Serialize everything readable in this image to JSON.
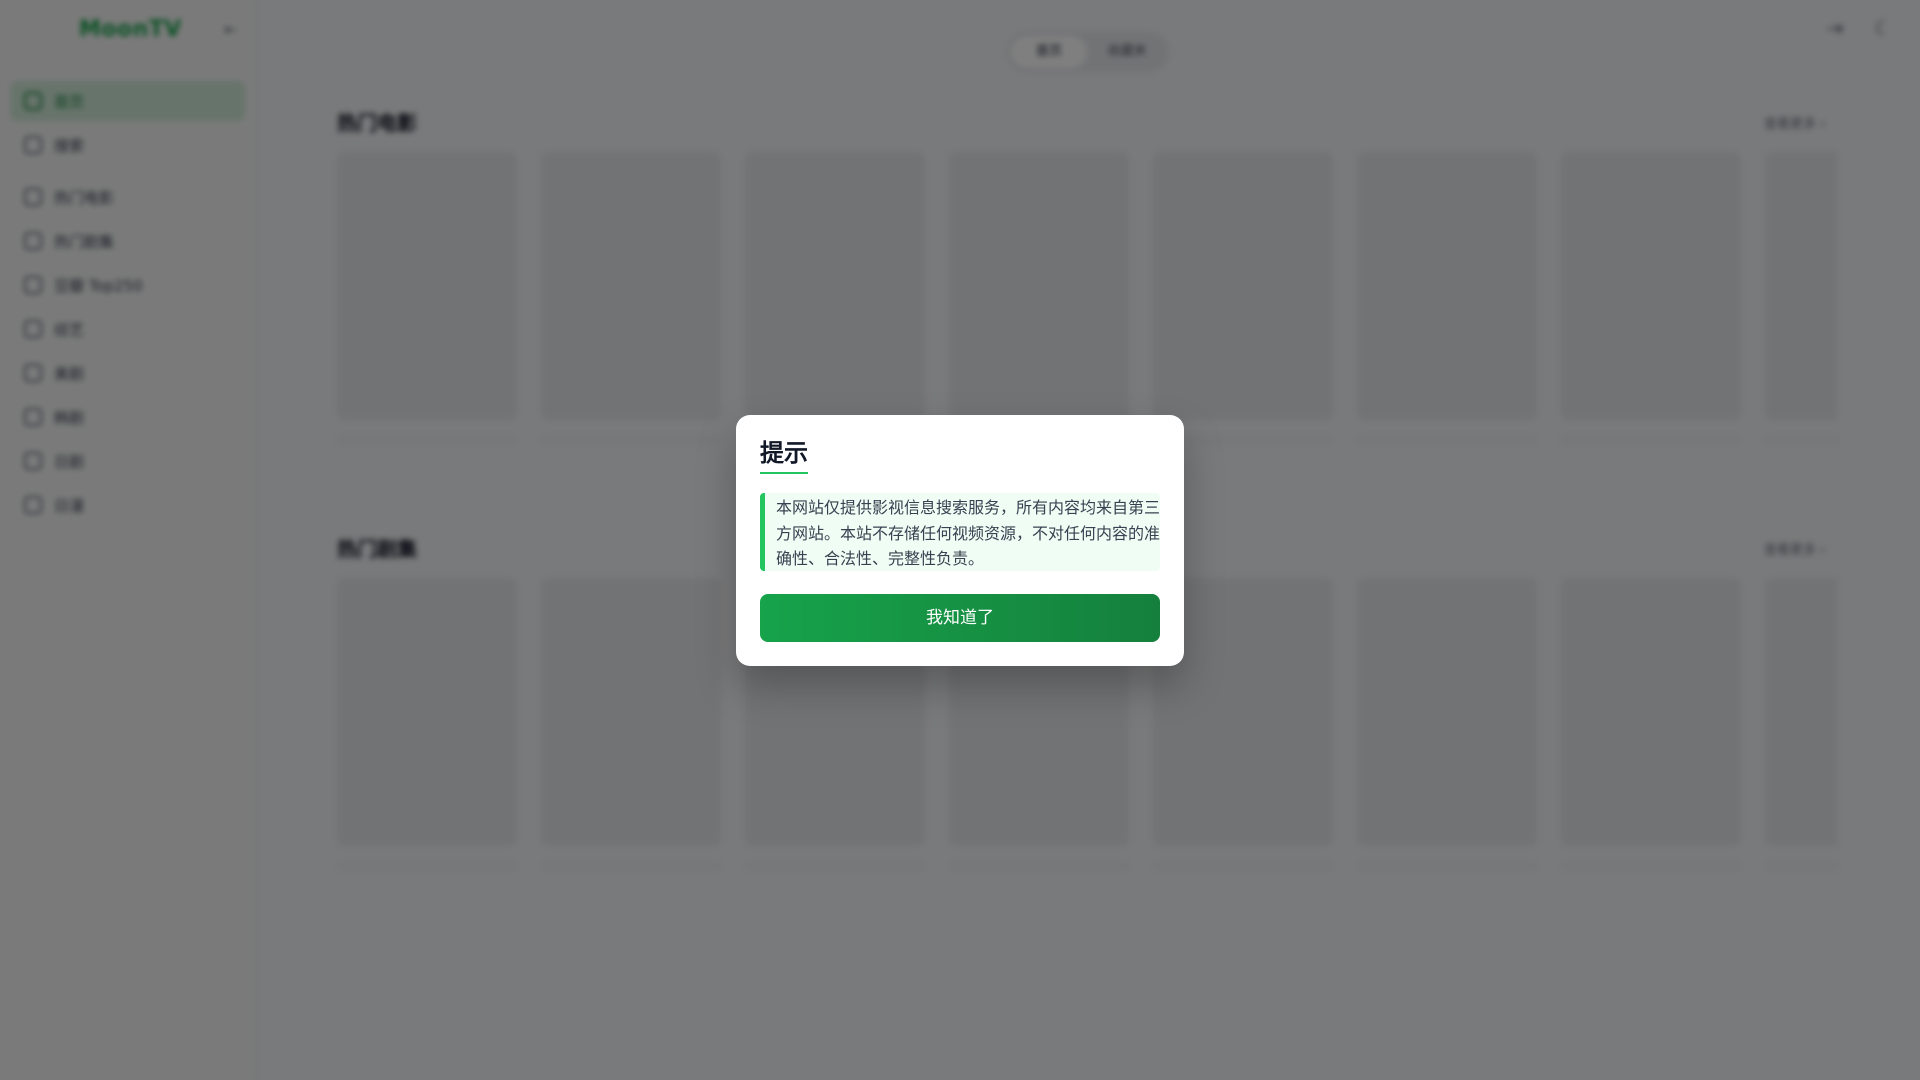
{
  "app": {
    "name": "MoonTV"
  },
  "sidebar": {
    "items": [
      {
        "label": "首页",
        "icon": "home-icon",
        "active": true
      },
      {
        "label": "搜索",
        "icon": "search-icon"
      },
      {
        "label": "热门电影",
        "icon": "film-icon"
      },
      {
        "label": "热门剧集",
        "icon": "tv-icon"
      },
      {
        "label": "豆瓣 Top250",
        "icon": "star-icon"
      },
      {
        "label": "综艺",
        "icon": "mic-icon"
      },
      {
        "label": "美剧",
        "icon": "globe-icon"
      },
      {
        "label": "韩剧",
        "icon": "flag-icon"
      },
      {
        "label": "日剧",
        "icon": "sun-icon"
      },
      {
        "label": "日漫",
        "icon": "sparkle-icon"
      }
    ]
  },
  "topbar": {
    "tabs": [
      "首页",
      "收藏夹"
    ]
  },
  "sections": [
    {
      "title": "热门电影",
      "more": "查看更多 ›"
    },
    {
      "title": "热门剧集",
      "more": "查看更多 ›"
    }
  ],
  "modal": {
    "title": "提示",
    "notice": "本网站仅提供影视信息搜索服务，所有内容均来自第三方网站。本站不存储任何视频资源，不对任何内容的准确性、合法性、完整性负责。",
    "confirm_label": "我知道了"
  },
  "colors": {
    "accent": "#16a34a",
    "accent_dark": "#15803d",
    "notice_bg": "#f0fdf4"
  }
}
